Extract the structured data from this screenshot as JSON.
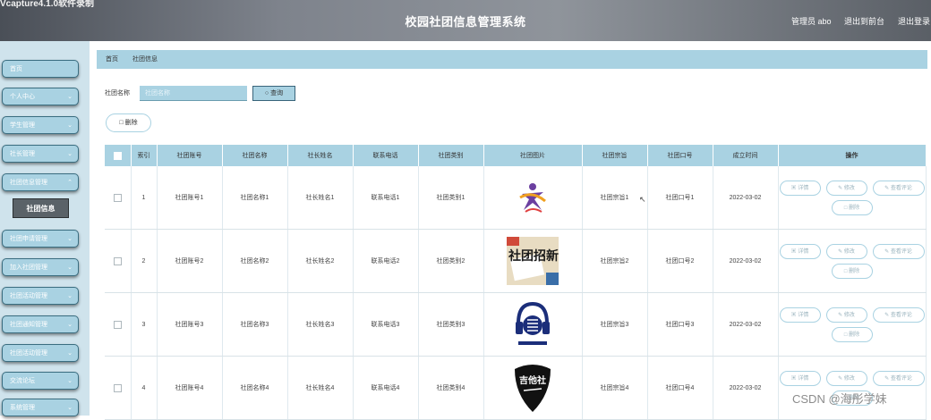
{
  "header": {
    "capture_text": "Vcapture4.1.0软件录制",
    "title": "校园社团信息管理系统",
    "admin_text": "管理员 abo",
    "link_home": "退出到前台",
    "link_logout": "退出登录"
  },
  "sidebar": {
    "items": [
      {
        "label": "首页"
      },
      {
        "label": "个人中心"
      },
      {
        "label": "学生管理"
      },
      {
        "label": "社长管理"
      },
      {
        "label": "社团信息管理"
      },
      {
        "label": "社团申请管理"
      },
      {
        "label": "加入社团管理"
      },
      {
        "label": "社团活动管理"
      },
      {
        "label": "社团通知管理"
      },
      {
        "label": "社团活动管理"
      },
      {
        "label": "交流论坛"
      },
      {
        "label": "系统管理"
      }
    ],
    "active_sub": "社团信息"
  },
  "breadcrumb": {
    "home": "首页",
    "current": "社团信息"
  },
  "search": {
    "label": "社团名称",
    "placeholder": "社团名称",
    "button": "查询",
    "delete": "删除"
  },
  "table": {
    "headers": [
      "索引",
      "社团账号",
      "社团名称",
      "社长姓名",
      "联系电话",
      "社团类别",
      "社团图片",
      "社团宗旨",
      "社团口号",
      "成立时间",
      "操作"
    ],
    "rows": [
      {
        "index": "1",
        "account": "社团账号1",
        "name": "社团名称1",
        "leader": "社长姓名1",
        "phone": "联系电话1",
        "category": "社团类别1",
        "purpose": "社团宗旨1",
        "slogan": "社团口号1",
        "date": "2022-03-02"
      },
      {
        "index": "2",
        "account": "社团账号2",
        "name": "社团名称2",
        "leader": "社长姓名2",
        "phone": "联系电话2",
        "category": "社团类别2",
        "purpose": "社团宗旨2",
        "slogan": "社团口号2",
        "date": "2022-03-02",
        "img_text": "社团招新"
      },
      {
        "index": "3",
        "account": "社团账号3",
        "name": "社团名称3",
        "leader": "社长姓名3",
        "phone": "联系电话3",
        "category": "社团类别3",
        "purpose": "社团宗旨3",
        "slogan": "社团口号3",
        "date": "2022-03-02"
      },
      {
        "index": "4",
        "account": "社团账号4",
        "name": "社团名称4",
        "leader": "社长姓名4",
        "phone": "联系电话4",
        "category": "社团类别4",
        "purpose": "社团宗旨4",
        "slogan": "社团口号4",
        "date": "2022-03-02",
        "img_text": "吉他社"
      }
    ],
    "actions": {
      "detail": "详情",
      "edit": "修改",
      "review": "查看评论",
      "delete": "删除"
    }
  },
  "watermark": "CSDN @海彤学妹",
  "colors": {
    "accent": "#a9d2e2",
    "sidebar_bg": "#cfe3ec",
    "active_sub": "#5a6268"
  }
}
